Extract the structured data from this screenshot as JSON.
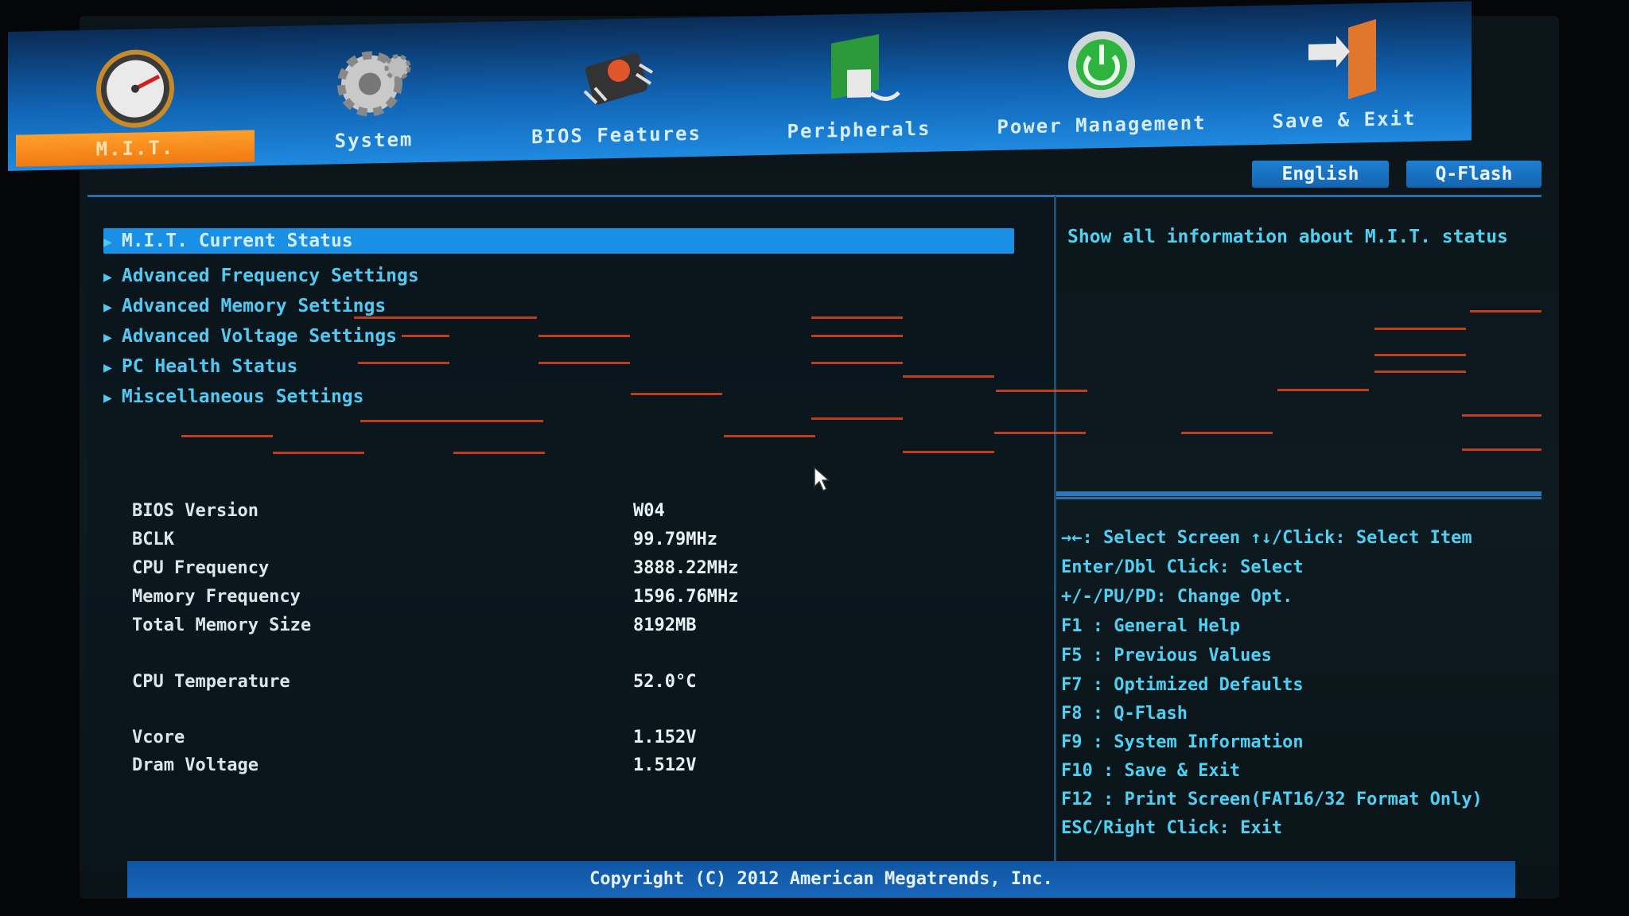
{
  "tabs": [
    {
      "label": "M.I.T.",
      "icon": "speedometer-icon",
      "active": true
    },
    {
      "label": "System",
      "icon": "gear-icon",
      "active": false
    },
    {
      "label": "BIOS Features",
      "icon": "chip-icon",
      "active": false
    },
    {
      "label": "Peripherals",
      "icon": "card-icon",
      "active": false
    },
    {
      "label": "Power Management",
      "icon": "power-icon",
      "active": false
    },
    {
      "label": "Save & Exit",
      "icon": "exit-door-icon",
      "active": false
    }
  ],
  "buttons": {
    "language": "English",
    "qflash": "Q-Flash"
  },
  "menu": [
    {
      "label": "M.I.T. Current Status"
    },
    {
      "label": "Advanced Frequency Settings"
    },
    {
      "label": "Advanced Memory Settings"
    },
    {
      "label": "Advanced Voltage Settings"
    },
    {
      "label": "PC Health Status"
    },
    {
      "label": "Miscellaneous Settings"
    }
  ],
  "info": [
    {
      "label": "BIOS Version",
      "value": "W04"
    },
    {
      "label": "BCLK",
      "value": "99.79MHz"
    },
    {
      "label": "CPU Frequency",
      "value": "3888.22MHz"
    },
    {
      "label": "Memory Frequency",
      "value": "1596.76MHz"
    },
    {
      "label": "Total Memory Size",
      "value": "8192MB"
    },
    {
      "label": "CPU Temperature",
      "value": "52.0°C"
    },
    {
      "label": "Vcore",
      "value": "1.152V"
    },
    {
      "label": "Dram Voltage",
      "value": "1.512V"
    }
  ],
  "help": "Show all information about M.I.T. status",
  "keys": [
    "→←: Select Screen  ↑↓/Click: Select Item",
    "Enter/Dbl Click: Select",
    "+/-/PU/PD: Change Opt.",
    "F1  : General Help",
    "F5  : Previous Values",
    "F7  : Optimized Defaults",
    "F8  : Q-Flash",
    "F9  : System Information",
    "F10 : Save & Exit",
    "F12 : Print Screen(FAT16/32 Format Only)",
    "ESC/Right Click: Exit"
  ],
  "footer": "Copyright (C) 2012 American Megatrends, Inc.",
  "colors": {
    "accent": "#1a8fe6",
    "active_tab": "#f07a12",
    "text": "#52c9f2"
  }
}
